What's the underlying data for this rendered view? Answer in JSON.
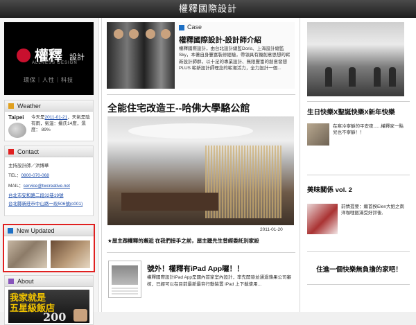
{
  "header": {
    "title": "權釋國際設計"
  },
  "logo": {
    "brand_cn": "權釋",
    "brand_cn2": "設計",
    "brand_en": "ALLNESS DESIGN",
    "tagline": "環保｜人性｜科技"
  },
  "weather": {
    "heading": "Weather",
    "heading_color": "#e0a020",
    "city": "Taipei",
    "text_prefix": "今天是",
    "date_link": "2011-01-21",
    "text_suffix": "，天氣是陰有雨，氣溫：攝氏14度，濕度： 89%",
    "icon": "cloud-icon"
  },
  "contact": {
    "heading": "Contact",
    "heading_color": "#e02020",
    "person": "主持設計師／洪博華",
    "tel_label": "TEL：",
    "tel": "0800-070-068",
    "mail_label": "MAIL：",
    "mail": "service@twcreative.net",
    "address1": "台北市安和路二段32巷19號",
    "address2": "台北縣新莊市中山路一段506號(c001)"
  },
  "new_updated": {
    "heading": "New Updated",
    "heading_color": "#1d6fc4"
  },
  "about": {
    "heading": "About",
    "heading_color": "#8855bb",
    "banner_line1": "我家就是",
    "banner_line2": "五星級飯店",
    "banner_number": "200"
  },
  "case": {
    "heading": "Case",
    "heading_color": "#1d6fc4",
    "title": "權釋國際設計-設計師介紹",
    "body": "權釋國際設計，由台北設計總監Doris、上海設計總監Sky，本著自身豐富裝修經驗，帶領具有獨創意思想的嶄新設計師群，以十足的專業設計、無限豐富的創意發想 PLUS 嶄新設計師理念的嶄潮活力，全力設計一個..."
  },
  "feature": {
    "title": "全能住宅改造王--哈佛大學駱公館",
    "date": "2011-01-20",
    "caption": "★屋主跟權釋的邂逅 在我們接手之前，屋主聽先生曾經委託別家設"
  },
  "ipad": {
    "title": "號外！權釋有iPad App囉！！",
    "body": "權釋國際設計iPad App是國內首家室內設計，率先開發並通過蘋果公司審核，已經可以在目前最新最夯行動裝置 iPad 上下載使用..."
  },
  "right": {
    "post1_title": "生日快樂X聖誕快樂X新年快樂",
    "post1_body": "在寒冷寧靜的平安夜......權釋家一點兒也不寧靜！！",
    "post2_title": "美味關係 vol. 2",
    "post2_body": "前情提要：繼首揆Elen大姐之南洋咖哩飯滿受好評後,",
    "post3_title": "住進一個快樂無負擔的家吧！"
  }
}
